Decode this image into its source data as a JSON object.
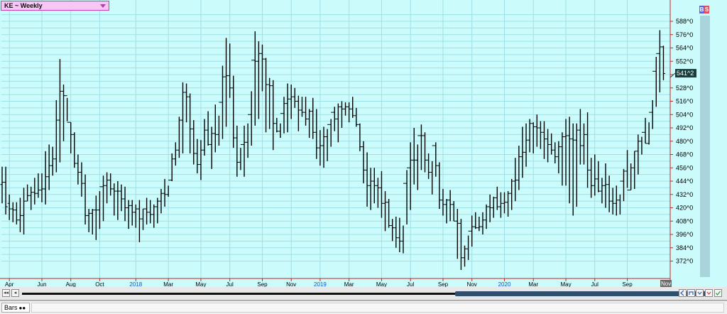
{
  "window": {
    "symbol_label": "KE ~ Weekly",
    "toggle_b": "B",
    "toggle_s": "S",
    "bottom_tab": "Bars",
    "bottom_tab_icon": "●●",
    "scroll_left_end": "◂◂",
    "scroll_left": "◂",
    "x_axis_current_tag": "Nov"
  },
  "colors": {
    "background": "#ccfbfc",
    "grid": "#9fe0e6",
    "axis_line": "#d02020",
    "bars": "#000000",
    "year_label": "#1050d0",
    "last_price_tag": "#1b3d3d",
    "toggle_b": "#5c62e6",
    "toggle_s": "#e0505a",
    "current_tag_bg": "#6a6a6a"
  },
  "chart_data": {
    "type": "ohlc",
    "title": "KE ~ Weekly",
    "y_axis_ticks": [
      "588^0",
      "576^0",
      "564^0",
      "552^0",
      "540^0",
      "528^0",
      "516^0",
      "504^0",
      "492^0",
      "480^0",
      "468^0",
      "456^0",
      "444^0",
      "432^0",
      "420^0",
      "408^0",
      "396^0",
      "384^0",
      "372^0"
    ],
    "ylim": [
      364,
      600
    ],
    "x_axis_labels": [
      {
        "label": "Apr",
        "week": 2,
        "is_year": false
      },
      {
        "label": "Jun",
        "week": 11,
        "is_year": false
      },
      {
        "label": "Aug",
        "week": 19,
        "is_year": false
      },
      {
        "label": "Oct",
        "week": 27,
        "is_year": false
      },
      {
        "label": "2018",
        "week": 37,
        "is_year": true
      },
      {
        "label": "Mar",
        "week": 46,
        "is_year": false
      },
      {
        "label": "May",
        "week": 55,
        "is_year": false
      },
      {
        "label": "Jul",
        "week": 63,
        "is_year": false
      },
      {
        "label": "Sep",
        "week": 72,
        "is_year": false
      },
      {
        "label": "Nov",
        "week": 80,
        "is_year": false
      },
      {
        "label": "2019",
        "week": 88,
        "is_year": true
      },
      {
        "label": "Mar",
        "week": 96,
        "is_year": false
      },
      {
        "label": "May",
        "week": 105,
        "is_year": false
      },
      {
        "label": "Jul",
        "week": 113,
        "is_year": false
      },
      {
        "label": "Sep",
        "week": 122,
        "is_year": false
      },
      {
        "label": "Nov",
        "week": 130,
        "is_year": false
      },
      {
        "label": "2020",
        "week": 139,
        "is_year": true
      },
      {
        "label": "Mar",
        "week": 147,
        "is_year": false
      },
      {
        "label": "May",
        "week": 156,
        "is_year": false
      },
      {
        "label": "Jul",
        "week": 164,
        "is_year": false
      },
      {
        "label": "Sep",
        "week": 173,
        "is_year": false
      }
    ],
    "last_price_label": "541^2",
    "last_price": 541.25,
    "grid": true,
    "bar_count": 184,
    "open": [
      441,
      443,
      424,
      419,
      418,
      409,
      413,
      426,
      431,
      434,
      433,
      436,
      437,
      448,
      458,
      464,
      499,
      525,
      521,
      497,
      486,
      460,
      452,
      442,
      413,
      415,
      418,
      418,
      439,
      440,
      445,
      437,
      435,
      435,
      428,
      420,
      422,
      416,
      419,
      410,
      419,
      416,
      414,
      421,
      426,
      433,
      432,
      445,
      464,
      472,
      499,
      524,
      520,
      491,
      469,
      459,
      472,
      490,
      477,
      487,
      486,
      515,
      538,
      539,
      528,
      483,
      461,
      477,
      479,
      504,
      553,
      552,
      559,
      554,
      531,
      530,
      496,
      489,
      505,
      514,
      518,
      520,
      516,
      508,
      506,
      500,
      507,
      488,
      474,
      476,
      484,
      495,
      506,
      500,
      511,
      509,
      511,
      509,
      503,
      495,
      475,
      454,
      440,
      444,
      440,
      438,
      424,
      425,
      404,
      402,
      393,
      390,
      442,
      456,
      463,
      463,
      485,
      485,
      463,
      452,
      476,
      458,
      427,
      423,
      427,
      423,
      408,
      406,
      375,
      383,
      399,
      403,
      402,
      403,
      409,
      421,
      420,
      429,
      421,
      424,
      425,
      433,
      444,
      445,
      466,
      470,
      481,
      496,
      493,
      492,
      488,
      482,
      477,
      472,
      466,
      475,
      484,
      485,
      482,
      481,
      490,
      476,
      486,
      454,
      440,
      446,
      435,
      440,
      441,
      426,
      424,
      427,
      444,
      453,
      436,
      456,
      471,
      480,
      488,
      478,
      506,
      543,
      559,
      565
    ],
    "high": [
      457,
      457,
      432,
      425,
      425,
      429,
      438,
      441,
      439,
      447,
      451,
      451,
      471,
      477,
      475,
      517,
      554,
      531,
      519,
      497,
      488,
      468,
      461,
      450,
      419,
      419,
      431,
      435,
      449,
      452,
      451,
      442,
      444,
      441,
      439,
      427,
      427,
      423,
      427,
      419,
      429,
      427,
      423,
      429,
      437,
      446,
      440,
      469,
      479,
      502,
      533,
      532,
      523,
      499,
      482,
      481,
      500,
      507,
      493,
      513,
      503,
      548,
      573,
      568,
      539,
      494,
      474,
      494,
      496,
      525,
      579,
      570,
      567,
      555,
      537,
      535,
      501,
      496,
      520,
      532,
      531,
      528,
      521,
      520,
      520,
      509,
      519,
      509,
      490,
      493,
      491,
      500,
      511,
      514,
      516,
      515,
      515,
      520,
      510,
      496,
      480,
      470,
      456,
      456,
      447,
      453,
      435,
      428,
      410,
      412,
      411,
      404,
      454,
      479,
      492,
      477,
      495,
      488,
      469,
      462,
      479,
      461,
      437,
      428,
      436,
      426,
      419,
      410,
      386,
      395,
      413,
      416,
      412,
      416,
      423,
      432,
      430,
      439,
      434,
      434,
      435,
      446,
      465,
      476,
      493,
      496,
      500,
      497,
      504,
      498,
      498,
      491,
      487,
      479,
      480,
      488,
      500,
      502,
      496,
      496,
      509,
      496,
      506,
      465,
      468,
      462,
      447,
      460,
      449,
      438,
      440,
      432,
      455,
      472,
      460,
      471,
      486,
      484,
      501,
      497,
      517,
      556,
      580,
      566
    ],
    "low": [
      424,
      414,
      409,
      407,
      405,
      398,
      396,
      426,
      418,
      423,
      429,
      425,
      423,
      436,
      449,
      452,
      461,
      480,
      498,
      469,
      456,
      441,
      430,
      405,
      398,
      396,
      391,
      401,
      408,
      424,
      431,
      413,
      409,
      417,
      408,
      401,
      404,
      402,
      389,
      400,
      405,
      406,
      402,
      406,
      415,
      421,
      430,
      444,
      458,
      465,
      469,
      497,
      469,
      459,
      451,
      445,
      467,
      476,
      455,
      470,
      476,
      482,
      493,
      519,
      474,
      448,
      454,
      448,
      465,
      476,
      494,
      500,
      525,
      488,
      491,
      472,
      488,
      483,
      487,
      488,
      500,
      510,
      489,
      502,
      494,
      483,
      482,
      464,
      458,
      456,
      462,
      475,
      489,
      479,
      492,
      503,
      497,
      501,
      493,
      471,
      442,
      421,
      418,
      424,
      420,
      411,
      399,
      402,
      390,
      384,
      380,
      379,
      405,
      418,
      441,
      436,
      454,
      452,
      446,
      432,
      448,
      419,
      413,
      406,
      408,
      408,
      374,
      364,
      367,
      373,
      385,
      401,
      399,
      396,
      401,
      407,
      411,
      418,
      411,
      415,
      412,
      418,
      426,
      436,
      447,
      457,
      470,
      469,
      475,
      473,
      464,
      461,
      468,
      460,
      451,
      440,
      440,
      424,
      413,
      421,
      459,
      459,
      438,
      429,
      431,
      434,
      424,
      420,
      416,
      414,
      413,
      414,
      426,
      438,
      436,
      437,
      450,
      468,
      478,
      477,
      491,
      511,
      524,
      535
    ],
    "close": [
      443,
      421,
      419,
      418,
      409,
      413,
      426,
      431,
      434,
      433,
      436,
      437,
      448,
      458,
      464,
      499,
      525,
      521,
      497,
      486,
      460,
      452,
      442,
      413,
      415,
      418,
      418,
      439,
      440,
      445,
      437,
      435,
      435,
      428,
      420,
      422,
      416,
      419,
      410,
      419,
      416,
      414,
      421,
      426,
      433,
      432,
      445,
      464,
      472,
      499,
      524,
      520,
      491,
      469,
      459,
      472,
      490,
      477,
      487,
      486,
      515,
      538,
      539,
      528,
      483,
      461,
      477,
      479,
      504,
      553,
      552,
      559,
      554,
      531,
      530,
      496,
      489,
      505,
      514,
      518,
      520,
      516,
      508,
      506,
      500,
      507,
      488,
      474,
      476,
      484,
      495,
      506,
      500,
      511,
      509,
      511,
      509,
      503,
      495,
      475,
      454,
      440,
      444,
      440,
      438,
      424,
      425,
      404,
      402,
      393,
      390,
      442,
      456,
      463,
      463,
      485,
      485,
      463,
      452,
      476,
      458,
      427,
      423,
      427,
      423,
      408,
      406,
      375,
      383,
      399,
      403,
      402,
      403,
      409,
      421,
      420,
      429,
      421,
      424,
      425,
      433,
      444,
      445,
      466,
      470,
      481,
      496,
      493,
      492,
      488,
      482,
      477,
      472,
      466,
      475,
      484,
      485,
      482,
      481,
      490,
      476,
      486,
      454,
      440,
      446,
      435,
      440,
      441,
      426,
      424,
      427,
      444,
      453,
      436,
      456,
      471,
      480,
      488,
      478,
      506,
      543,
      559,
      565,
      541
    ]
  }
}
